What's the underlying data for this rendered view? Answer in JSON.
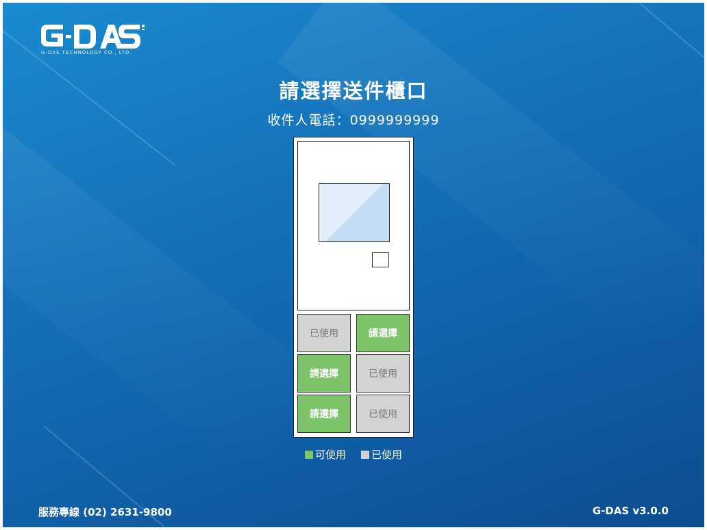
{
  "brand": {
    "logo_text": "G-DAS",
    "company": "G-DAS TECHNOLOGY CO., LTD."
  },
  "heading": {
    "title": "請選擇送件櫃口",
    "phone_label": "收件人電話：",
    "phone_value": "0999999999"
  },
  "lockers": [
    {
      "label": "已使用",
      "status": "used"
    },
    {
      "label": "請選擇",
      "status": "available"
    },
    {
      "label": "請選擇",
      "status": "available"
    },
    {
      "label": "已使用",
      "status": "used"
    },
    {
      "label": "請選擇",
      "status": "available"
    },
    {
      "label": "已使用",
      "status": "used"
    }
  ],
  "legend": {
    "available_label": "可使用",
    "used_label": "已使用"
  },
  "colors": {
    "available": "#7cc36a",
    "used": "#d3d3d3",
    "background": "#1573bb"
  },
  "footer": {
    "hotline": "服務專線 (02) 2631-9800",
    "version": "G-DAS v3.0.0"
  }
}
